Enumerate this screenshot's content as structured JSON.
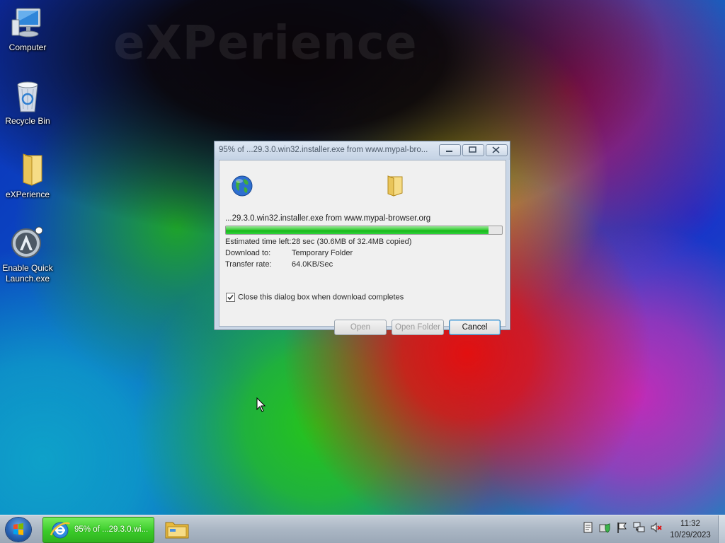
{
  "desktop": {
    "watermark": "eXPerience",
    "icons": [
      {
        "label": "Computer",
        "icon": "computer-icon"
      },
      {
        "label": "Recycle Bin",
        "icon": "recycle-bin-icon"
      },
      {
        "label": "eXPerience",
        "icon": "folder-icon"
      },
      {
        "label": "Enable Quick Launch.exe",
        "icon": "quick-launch-app-icon"
      }
    ]
  },
  "dialog": {
    "title": "95% of ...29.3.0.win32.installer.exe from www.mypal-bro...",
    "file_line": "...29.3.0.win32.installer.exe from www.mypal-browser.org",
    "progress_percent": 95,
    "rows": [
      {
        "key": "Estimated time left:",
        "value": "28 sec (30.6MB of 32.4MB copied)"
      },
      {
        "key": "Download to:",
        "value": "Temporary Folder"
      },
      {
        "key": "Transfer rate:",
        "value": "64.0KB/Sec"
      }
    ],
    "checkbox_label": "Close this dialog box when download completes",
    "checkbox_checked": true,
    "buttons": {
      "open": "Open",
      "open_folder": "Open Folder",
      "cancel": "Cancel"
    }
  },
  "taskbar": {
    "active_task_label": "95% of ...29.3.0.wi...",
    "clock_time": "11:32",
    "clock_date": "10/29/2023",
    "active_task_color": "#3acb29"
  }
}
